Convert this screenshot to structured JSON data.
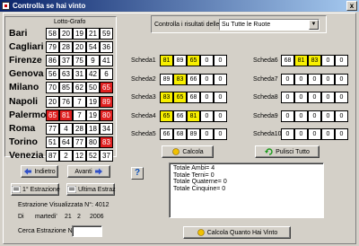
{
  "window": {
    "title": "Controlla se hai vinto",
    "close": "x"
  },
  "grid": {
    "caption": "Lotto-Grafo",
    "rows": [
      {
        "city": "Bari",
        "numbers": [
          "58",
          "20",
          "19",
          "21",
          "59"
        ],
        "hits": [
          false,
          false,
          false,
          false,
          false
        ]
      },
      {
        "city": "Cagliari",
        "numbers": [
          "79",
          "28",
          "20",
          "54",
          "36"
        ],
        "hits": [
          false,
          false,
          false,
          false,
          false
        ]
      },
      {
        "city": "Firenze",
        "numbers": [
          "86",
          "37",
          "75",
          "9",
          "41"
        ],
        "hits": [
          false,
          false,
          false,
          false,
          false
        ]
      },
      {
        "city": "Genova",
        "numbers": [
          "56",
          "63",
          "31",
          "42",
          "6"
        ],
        "hits": [
          false,
          false,
          false,
          false,
          false
        ]
      },
      {
        "city": "Milano",
        "numbers": [
          "70",
          "85",
          "62",
          "50",
          "65"
        ],
        "hits": [
          false,
          false,
          false,
          false,
          true
        ]
      },
      {
        "city": "Napoli",
        "numbers": [
          "20",
          "76",
          "7",
          "19",
          "89"
        ],
        "hits": [
          false,
          false,
          false,
          false,
          true
        ]
      },
      {
        "city": "Palermo",
        "numbers": [
          "65",
          "81",
          "7",
          "19",
          "80"
        ],
        "hits": [
          true,
          true,
          false,
          false,
          true
        ]
      },
      {
        "city": "Roma",
        "numbers": [
          "77",
          "4",
          "28",
          "18",
          "34"
        ],
        "hits": [
          false,
          false,
          false,
          false,
          false
        ]
      },
      {
        "city": "Torino",
        "numbers": [
          "51",
          "64",
          "77",
          "80",
          "83"
        ],
        "hits": [
          false,
          false,
          false,
          false,
          true
        ]
      },
      {
        "city": "Venezia",
        "numbers": [
          "87",
          "2",
          "12",
          "52",
          "37"
        ],
        "hits": [
          false,
          false,
          false,
          false,
          false
        ]
      }
    ]
  },
  "nav": {
    "back": "Indietro",
    "forward": "Avanti",
    "first": "1° Estrazione",
    "last": "Ultima Estraz"
  },
  "extraction": {
    "label": "Estrazione Visualizzata N°:",
    "number": "4012",
    "di": "Di",
    "weekday": "martedi'",
    "day": "21",
    "month": "2",
    "year": "2006",
    "search_label": "Cerca Estrazione N°:",
    "search_value": ""
  },
  "control": {
    "label": "Controlla i risultati delle 10 schede",
    "selected": "Su Tutte le Ruote"
  },
  "schede_left": [
    {
      "name": "Scheda1",
      "values": [
        "81",
        "89",
        "65",
        "0",
        "0"
      ],
      "hits": [
        true,
        false,
        true,
        false,
        false
      ]
    },
    {
      "name": "Scheda2",
      "values": [
        "89",
        "83",
        "66",
        "0",
        "0"
      ],
      "hits": [
        false,
        true,
        false,
        false,
        false
      ]
    },
    {
      "name": "Scheda3",
      "values": [
        "83",
        "65",
        "68",
        "0",
        "0"
      ],
      "hits": [
        true,
        true,
        false,
        false,
        false
      ]
    },
    {
      "name": "Scheda4",
      "values": [
        "65",
        "66",
        "81",
        "0",
        "0"
      ],
      "hits": [
        true,
        false,
        true,
        false,
        false
      ]
    },
    {
      "name": "Scheda5",
      "values": [
        "66",
        "68",
        "89",
        "0",
        "0"
      ],
      "hits": [
        false,
        false,
        false,
        false,
        false
      ]
    }
  ],
  "schede_right": [
    {
      "name": "Scheda6",
      "values": [
        "68",
        "81",
        "83",
        "0",
        "0"
      ],
      "hits": [
        false,
        true,
        true,
        false,
        false
      ]
    },
    {
      "name": "Scheda7",
      "values": [
        "0",
        "0",
        "0",
        "0",
        "0"
      ],
      "hits": [
        false,
        false,
        false,
        false,
        false
      ]
    },
    {
      "name": "Scheda8",
      "values": [
        "0",
        "0",
        "0",
        "0",
        "0"
      ],
      "hits": [
        false,
        false,
        false,
        false,
        false
      ]
    },
    {
      "name": "Scheda9",
      "values": [
        "0",
        "0",
        "0",
        "0",
        "0"
      ],
      "hits": [
        false,
        false,
        false,
        false,
        false
      ]
    },
    {
      "name": "Scheda10",
      "values": [
        "0",
        "0",
        "0",
        "0",
        "0"
      ],
      "hits": [
        false,
        false,
        false,
        false,
        false
      ]
    }
  ],
  "actions": {
    "calcola": "Calcola",
    "pulisci": "Pulisci Tutto",
    "calcola_vinto": "Calcola Quanto Hai Vinto",
    "help": "?"
  },
  "results": [
    "Totale Ambi= 4",
    "Totale Terni= 0",
    "Totale Quaterne= 0",
    "Totale Cinquine= 0"
  ],
  "colors": {
    "hit_red": "#e02020",
    "hit_yellow": "#f8f000",
    "titlebar": "#0a246a"
  }
}
